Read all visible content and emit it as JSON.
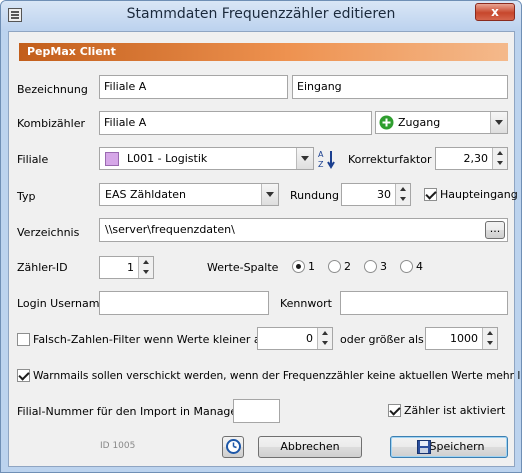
{
  "window": {
    "title": "Stammdaten Frequenzzähler editieren",
    "close": "x"
  },
  "banner": "PepMax Client",
  "fields": {
    "bezeichnung_label": "Bezeichnung",
    "bezeichnung1": "Filiale A",
    "bezeichnung2": "Eingang",
    "kombi_label": "Kombizähler",
    "kombi_value": "Filiale A",
    "kombi_select": "Zugang",
    "filiale_label": "Filiale",
    "filiale_value": "L001 - Logistik",
    "korrektur_label": "Korrekturfaktor",
    "korrektur_value": "2,30",
    "typ_label": "Typ",
    "typ_value": "EAS Zähldaten",
    "rundung_label": "Rundung",
    "rundung_value": "30",
    "haupteingang_label": "Haupteingang",
    "verzeichnis_label": "Verzeichnis",
    "verzeichnis_value": "\\\\server\\frequenzdaten\\",
    "browse": "...",
    "zaehler_id_label": "Zähler-ID",
    "zaehler_id_value": "1",
    "werte_spalte_label": "Werte-Spalte",
    "radio": [
      "1",
      "2",
      "3",
      "4"
    ],
    "login_label": "Login Username",
    "login_value": "",
    "kennwort_label": "Kennwort",
    "kennwort_value": "",
    "falsch_label": "Falsch-Zahlen-Filter wenn Werte kleiner als",
    "falsch_min": "0",
    "oder_label": "oder größer als",
    "falsch_max": "1000",
    "warnmails_label": "Warnmails sollen verschickt werden, wenn der Frequenzzähler keine aktuellen Werte mehr liefert",
    "filial_nr_label": "Filial-Nummer für den Import in ManageMax",
    "filial_nr_value": "",
    "aktiviert_label": "Zähler ist aktiviert",
    "id_label": "ID 1005"
  },
  "buttons": {
    "abbrechen": "Abbrechen",
    "speichern": "Speichern"
  },
  "state": {
    "haupteingang": true,
    "werte_spalte_selected": "1",
    "falsch_filter": false,
    "warnmails": true,
    "aktiviert": true
  },
  "colors": {
    "banner": "#e07a34",
    "filiale_swatch": "#d6a7e8",
    "plus_icon": "#2f9e2f"
  }
}
